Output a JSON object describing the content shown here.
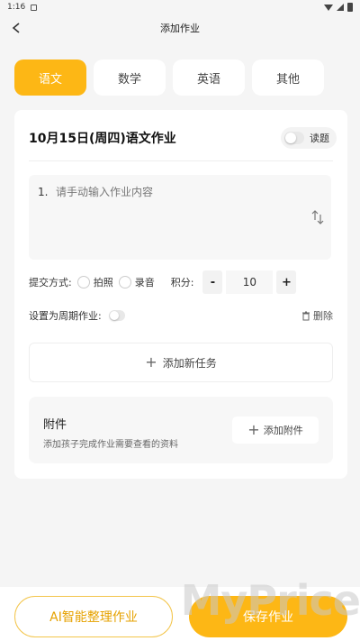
{
  "status_bar": {
    "time": "1:16"
  },
  "nav": {
    "title": "添加作业"
  },
  "subjects": [
    {
      "label": "语文",
      "active": true
    },
    {
      "label": "数学",
      "active": false
    },
    {
      "label": "英语",
      "active": false
    },
    {
      "label": "其他",
      "active": false
    }
  ],
  "card": {
    "title": "10月15日(周四)语文作业",
    "read_label": "读题",
    "content_index": "1.",
    "content_placeholder": "请手动输入作业内容",
    "submit_label": "提交方式:",
    "option_photo": "拍照",
    "option_audio": "录音",
    "score_label": "积分:",
    "score_value": "10",
    "minus": "-",
    "plus": "+",
    "periodic_label": "设置为周期作业:",
    "delete_label": "删除",
    "add_task_label": "添加新任务",
    "attach_title": "附件",
    "attach_desc": "添加孩子完成作业需要查看的资料",
    "attach_button": "添加附件"
  },
  "bottom": {
    "ai_button": "AI智能整理作业",
    "save_button": "保存作业"
  },
  "watermark": "MyPrice",
  "colors": {
    "accent": "#fdb715"
  },
  "icons": [
    "back-arrow-icon",
    "sort-icon",
    "trash-icon",
    "plus-icon"
  ]
}
